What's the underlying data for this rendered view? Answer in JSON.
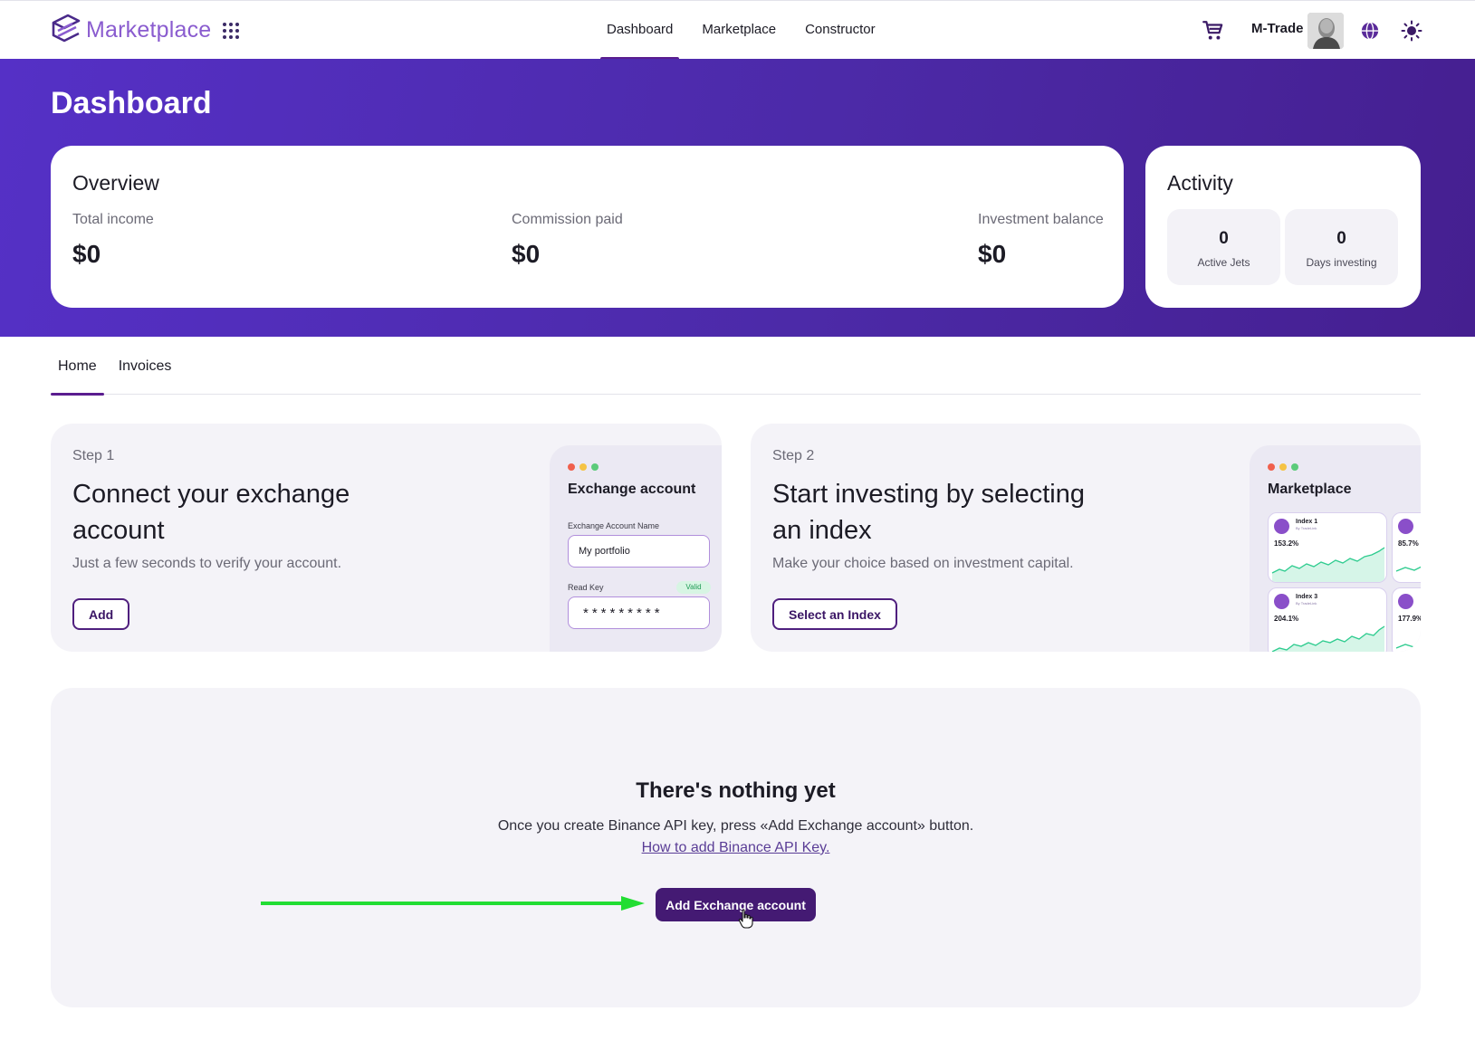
{
  "header": {
    "logo_text": "Marketplace",
    "nav": [
      {
        "label": "Dashboard",
        "active": true
      },
      {
        "label": "Marketplace",
        "active": false
      },
      {
        "label": "Constructor",
        "active": false
      }
    ],
    "user_name": "M-Trade",
    "icons": [
      "logo-icon",
      "apps-grid-icon",
      "cart-icon",
      "globe-icon",
      "sun-icon"
    ]
  },
  "hero": {
    "title": "Dashboard",
    "overview": {
      "title": "Overview",
      "stats": [
        {
          "label": "Total income",
          "value": "$0"
        },
        {
          "label": "Commission paid",
          "value": "$0"
        },
        {
          "label": "Investment balance",
          "value": "$0"
        }
      ]
    },
    "activity": {
      "title": "Activity",
      "items": [
        {
          "value": "0",
          "label": "Active Jets"
        },
        {
          "value": "0",
          "label": "Days investing"
        }
      ]
    }
  },
  "tabs": [
    {
      "label": "Home",
      "active": true
    },
    {
      "label": "Invoices",
      "active": false
    }
  ],
  "steps": [
    {
      "kicker": "Step 1",
      "title": "Connect your exchange account",
      "desc": "Just a few seconds to verify your account.",
      "button": "Add",
      "mock": {
        "title": "Exchange account",
        "name_label": "Exchange Account Name",
        "name_value": "My portfolio",
        "key_label": "Read Key",
        "key_badge": "Valid",
        "key_value": "*********"
      }
    },
    {
      "kicker": "Step 2",
      "title": "Start investing by selecting an index",
      "desc": "Make your choice based on investment capital.",
      "button": "Select an Index",
      "mock": {
        "title": "Marketplace",
        "cards": [
          {
            "name": "Index 1",
            "by": "By TradeLink",
            "value": "153.2%"
          },
          {
            "name": "",
            "by": "",
            "value": "85.7%"
          },
          {
            "name": "Index 3",
            "by": "By TradeLink",
            "value": "204.1%"
          },
          {
            "name": "",
            "by": "",
            "value": "177.9%"
          }
        ]
      }
    }
  ],
  "empty_state": {
    "title": "There's nothing yet",
    "desc": "Once you create Binance API key, press «Add Exchange account» button.",
    "link": "How to add Binance API Key.",
    "button": "Add Exchange account"
  },
  "colors": {
    "brand": "#5a1d8f",
    "hero_gradient_start": "#5530c6",
    "hero_gradient_end": "#451f90",
    "annotation_arrow": "#22dd33",
    "chart_green": "#2ecc8f"
  }
}
